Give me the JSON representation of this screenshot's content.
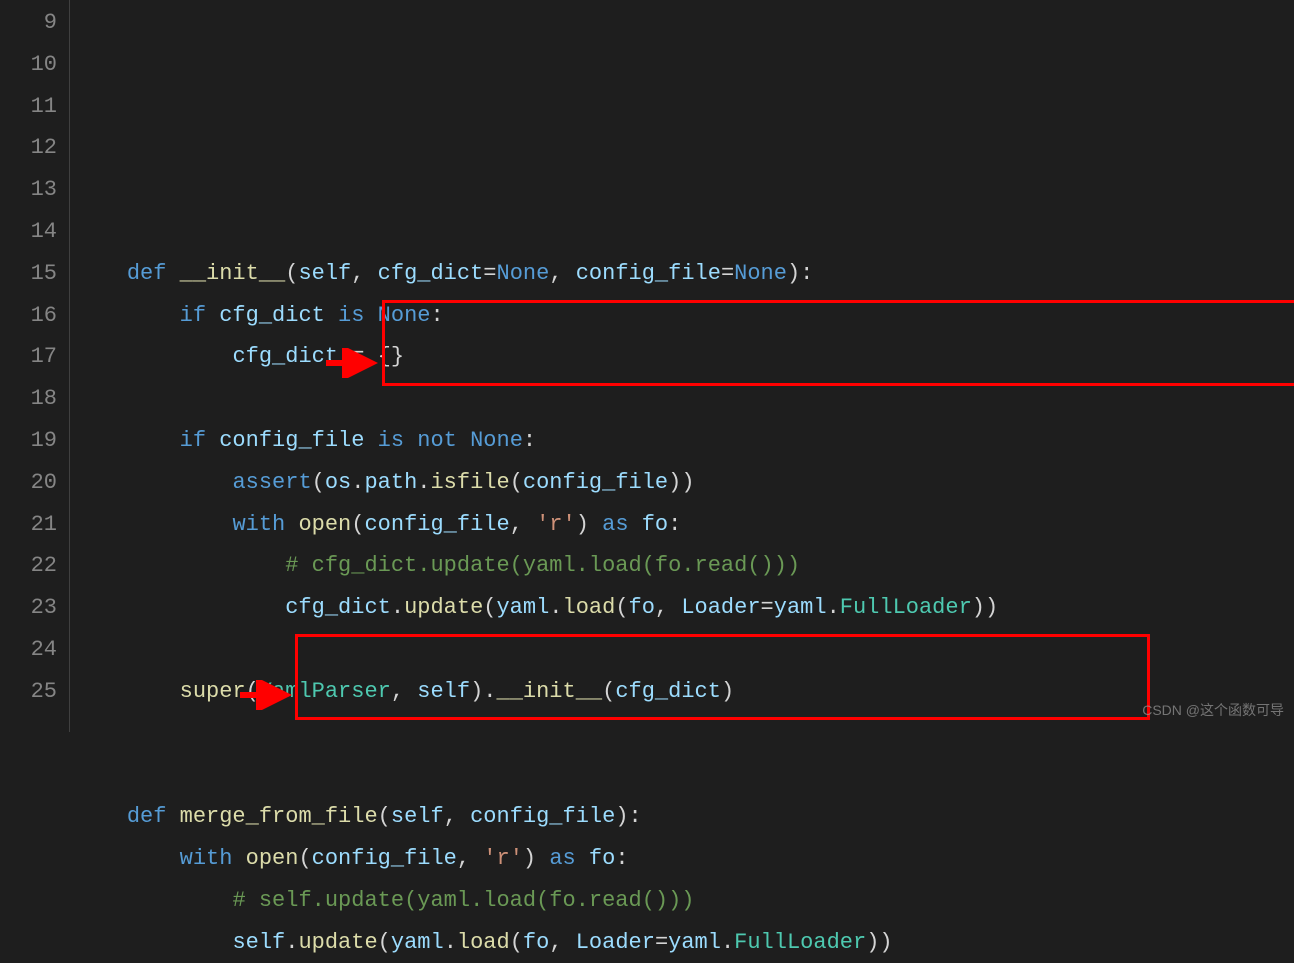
{
  "line_numbers": [
    "9",
    "10",
    "11",
    "12",
    "13",
    "14",
    "15",
    "16",
    "17",
    "18",
    "19",
    "20",
    "21",
    "22",
    "23",
    "24",
    "25"
  ],
  "code_lines": {
    "l9": {
      "indent": "    ",
      "tokens": [
        {
          "t": "def ",
          "c": "kw"
        },
        {
          "t": "__init__",
          "c": "fn"
        },
        {
          "t": "(",
          "c": "op"
        },
        {
          "t": "self",
          "c": "var"
        },
        {
          "t": ", ",
          "c": "op"
        },
        {
          "t": "cfg_dict",
          "c": "var"
        },
        {
          "t": "=",
          "c": "op"
        },
        {
          "t": "None",
          "c": "kw"
        },
        {
          "t": ", ",
          "c": "op"
        },
        {
          "t": "config_file",
          "c": "var"
        },
        {
          "t": "=",
          "c": "op"
        },
        {
          "t": "None",
          "c": "kw"
        },
        {
          "t": "):",
          "c": "op"
        }
      ]
    },
    "l10": {
      "indent": "        ",
      "tokens": [
        {
          "t": "if ",
          "c": "kw"
        },
        {
          "t": "cfg_dict",
          "c": "var"
        },
        {
          "t": " is ",
          "c": "kw"
        },
        {
          "t": "None",
          "c": "kw"
        },
        {
          "t": ":",
          "c": "op"
        }
      ]
    },
    "l11": {
      "indent": "            ",
      "tokens": [
        {
          "t": "cfg_dict",
          "c": "var"
        },
        {
          "t": " = {}",
          "c": "op"
        }
      ]
    },
    "l12": {
      "indent": "",
      "tokens": []
    },
    "l13": {
      "indent": "        ",
      "tokens": [
        {
          "t": "if ",
          "c": "kw"
        },
        {
          "t": "config_file",
          "c": "var"
        },
        {
          "t": " is not ",
          "c": "kw"
        },
        {
          "t": "None",
          "c": "kw"
        },
        {
          "t": ":",
          "c": "op"
        }
      ]
    },
    "l14": {
      "indent": "            ",
      "tokens": [
        {
          "t": "assert",
          "c": "kw"
        },
        {
          "t": "(",
          "c": "op"
        },
        {
          "t": "os",
          "c": "var"
        },
        {
          "t": ".",
          "c": "op"
        },
        {
          "t": "path",
          "c": "var"
        },
        {
          "t": ".",
          "c": "op"
        },
        {
          "t": "isfile",
          "c": "fn"
        },
        {
          "t": "(",
          "c": "op"
        },
        {
          "t": "config_file",
          "c": "var"
        },
        {
          "t": "))",
          "c": "op"
        }
      ]
    },
    "l15": {
      "indent": "            ",
      "tokens": [
        {
          "t": "with ",
          "c": "kw"
        },
        {
          "t": "open",
          "c": "fn"
        },
        {
          "t": "(",
          "c": "op"
        },
        {
          "t": "config_file",
          "c": "var"
        },
        {
          "t": ", ",
          "c": "op"
        },
        {
          "t": "'r'",
          "c": "str"
        },
        {
          "t": ") ",
          "c": "op"
        },
        {
          "t": "as ",
          "c": "kw"
        },
        {
          "t": "fo",
          "c": "var"
        },
        {
          "t": ":",
          "c": "op"
        }
      ]
    },
    "l16": {
      "indent": "                ",
      "tokens": [
        {
          "t": "# cfg_dict.update(yaml.load(fo.read()))",
          "c": "com"
        }
      ]
    },
    "l17": {
      "indent": "                ",
      "tokens": [
        {
          "t": "cfg_dict",
          "c": "var"
        },
        {
          "t": ".",
          "c": "op"
        },
        {
          "t": "update",
          "c": "fn"
        },
        {
          "t": "(",
          "c": "op"
        },
        {
          "t": "yaml",
          "c": "var"
        },
        {
          "t": ".",
          "c": "op"
        },
        {
          "t": "load",
          "c": "fn"
        },
        {
          "t": "(",
          "c": "op"
        },
        {
          "t": "fo",
          "c": "var"
        },
        {
          "t": ", ",
          "c": "op"
        },
        {
          "t": "Loader",
          "c": "var"
        },
        {
          "t": "=",
          "c": "op"
        },
        {
          "t": "yaml",
          "c": "var"
        },
        {
          "t": ".",
          "c": "op"
        },
        {
          "t": "FullLoader",
          "c": "cls"
        },
        {
          "t": "))",
          "c": "op"
        }
      ]
    },
    "l18": {
      "indent": "",
      "tokens": []
    },
    "l19": {
      "indent": "        ",
      "tokens": [
        {
          "t": "super",
          "c": "fn"
        },
        {
          "t": "(",
          "c": "op"
        },
        {
          "t": "YamlParser",
          "c": "cls"
        },
        {
          "t": ", ",
          "c": "op"
        },
        {
          "t": "self",
          "c": "var"
        },
        {
          "t": ").",
          "c": "op"
        },
        {
          "t": "__init__",
          "c": "fn"
        },
        {
          "t": "(",
          "c": "op"
        },
        {
          "t": "cfg_dict",
          "c": "var"
        },
        {
          "t": ")",
          "c": "op"
        }
      ]
    },
    "l20": {
      "indent": "",
      "tokens": []
    },
    "l21": {
      "indent": "",
      "tokens": []
    },
    "l22": {
      "indent": "    ",
      "tokens": [
        {
          "t": "def ",
          "c": "kw"
        },
        {
          "t": "merge_from_file",
          "c": "fn"
        },
        {
          "t": "(",
          "c": "op"
        },
        {
          "t": "self",
          "c": "var"
        },
        {
          "t": ", ",
          "c": "op"
        },
        {
          "t": "config_file",
          "c": "var"
        },
        {
          "t": "):",
          "c": "op"
        }
      ]
    },
    "l23": {
      "indent": "        ",
      "tokens": [
        {
          "t": "with ",
          "c": "kw"
        },
        {
          "t": "open",
          "c": "fn"
        },
        {
          "t": "(",
          "c": "op"
        },
        {
          "t": "config_file",
          "c": "var"
        },
        {
          "t": ", ",
          "c": "op"
        },
        {
          "t": "'r'",
          "c": "str"
        },
        {
          "t": ") ",
          "c": "op"
        },
        {
          "t": "as ",
          "c": "kw"
        },
        {
          "t": "fo",
          "c": "var"
        },
        {
          "t": ":",
          "c": "op"
        }
      ]
    },
    "l24": {
      "indent": "            ",
      "tokens": [
        {
          "t": "# self.update(yaml.load(fo.read()))",
          "c": "com"
        }
      ]
    },
    "l25": {
      "indent": "            ",
      "tokens": [
        {
          "t": "self",
          "c": "var"
        },
        {
          "t": ".",
          "c": "op"
        },
        {
          "t": "update",
          "c": "fn"
        },
        {
          "t": "(",
          "c": "op"
        },
        {
          "t": "yaml",
          "c": "var"
        },
        {
          "t": ".",
          "c": "op"
        },
        {
          "t": "load",
          "c": "fn"
        },
        {
          "t": "(",
          "c": "op"
        },
        {
          "t": "fo",
          "c": "var"
        },
        {
          "t": ", ",
          "c": "op"
        },
        {
          "t": "Loader",
          "c": "var"
        },
        {
          "t": "=",
          "c": "op"
        },
        {
          "t": "yaml",
          "c": "var"
        },
        {
          "t": ".",
          "c": "op"
        },
        {
          "t": "FullLoader",
          "c": "cls"
        },
        {
          "t": "))",
          "c": "op"
        }
      ]
    }
  },
  "watermark": "CSDN @这个函数可导"
}
